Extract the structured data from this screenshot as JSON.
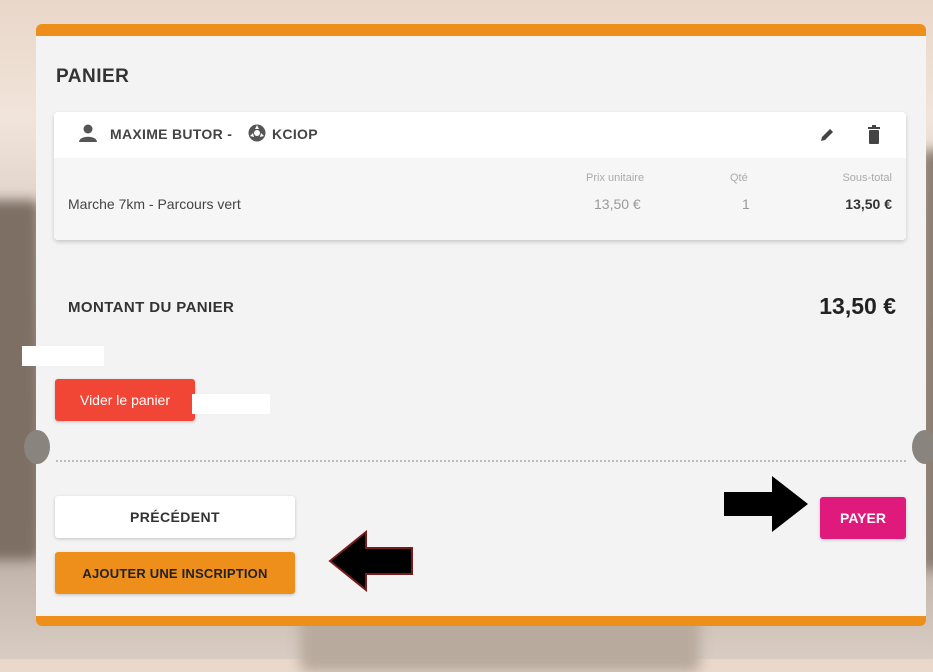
{
  "cart": {
    "title": "PANIER",
    "item": {
      "person": "MAXIME BUTOR",
      "separator": "-",
      "club": "KCIOP",
      "headers": {
        "unit_price": "Prix unitaire",
        "qty": "Qté",
        "subtotal": "Sous-total"
      },
      "product": "Marche 7km - Parcours vert",
      "unit_price": "13,50 €",
      "qty": "1",
      "subtotal": "13,50 €"
    },
    "total_label": "MONTANT DU PANIER",
    "total_value": "13,50 €"
  },
  "buttons": {
    "clear": "Vider le panier",
    "previous": "PRÉCÉDENT",
    "add_registration": "AJOUTER UNE INSCRIPTION",
    "pay": "PAYER"
  },
  "colors": {
    "accent_orange": "#ef8f1b",
    "pay_pink": "#e0197c",
    "clear_red": "#f14635"
  }
}
